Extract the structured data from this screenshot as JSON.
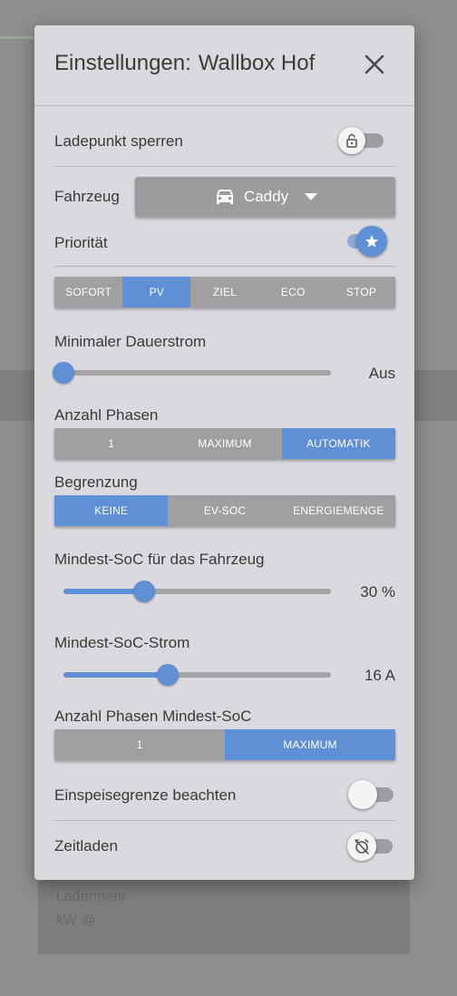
{
  "background": {
    "card_label": "Ladermeni",
    "card_value": "kW @"
  },
  "dialog": {
    "title_prefix": "Einstellungen:",
    "title_name": "Wallbox Hof",
    "lock_label": "Ladepunkt sperren",
    "lock_on": false,
    "vehicle_label": "Fahrzeug",
    "vehicle_value": "Caddy",
    "priority_label": "Priorität",
    "priority_on": true,
    "charge_modes": [
      "SOFORT",
      "PV",
      "ZIEL",
      "ECO",
      "STOP"
    ],
    "charge_mode_active": 1,
    "min_current": {
      "label": "Minimaler Dauerstrom",
      "value_text": "Aus",
      "position": 0
    },
    "phases": {
      "label": "Anzahl Phasen",
      "options": [
        "1",
        "MAXIMUM",
        "AUTOMATIK"
      ],
      "active": 2
    },
    "limit": {
      "label": "Begrenzung",
      "options": [
        "KEINE",
        "EV-SOC",
        "ENERGIEMENGE"
      ],
      "active": 0
    },
    "min_soc": {
      "label": "Mindest-SoC für das Fahrzeug",
      "value_text": "30 %",
      "value": 30,
      "position": 0.3
    },
    "min_soc_current": {
      "label": "Mindest-SoC-Strom",
      "value_text": "16 A",
      "value": 16,
      "position": 0.39
    },
    "min_soc_phases": {
      "label": "Anzahl Phasen Mindest-SoC",
      "options": [
        "1",
        "MAXIMUM"
      ],
      "active": 1
    },
    "feed_in_label": "Einspeisegrenze beachten",
    "feed_in_on": false,
    "timed_label": "Zeitladen",
    "timed_on": false
  },
  "colors": {
    "accent": "#5f8fd4",
    "inactive": "#a0a0a3",
    "panel": "#d9d9de"
  }
}
